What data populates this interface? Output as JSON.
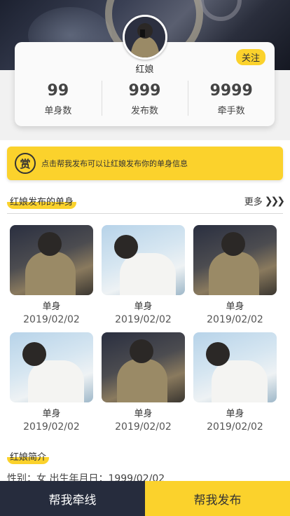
{
  "header": {
    "follow_label": "关注",
    "name": "红娘"
  },
  "stats": [
    {
      "value": "99",
      "label": "单身数"
    },
    {
      "value": "999",
      "label": "发布数"
    },
    {
      "value": "9999",
      "label": "牵手数"
    }
  ],
  "notice": {
    "icon_char": "赏",
    "text": "点击帮我发布可以让红娘发布你的单身信息"
  },
  "singles_section": {
    "title": "红娘发布的单身",
    "more_label": "更多",
    "more_icon": "❯❯❯"
  },
  "singles": [
    {
      "title": "单身",
      "date": "2019/02/02",
      "photo": "a"
    },
    {
      "title": "单身",
      "date": "2019/02/02",
      "photo": "b"
    },
    {
      "title": "单身",
      "date": "2019/02/02",
      "photo": "a"
    },
    {
      "title": "单身",
      "date": "2019/02/02",
      "photo": "b"
    },
    {
      "title": "单身",
      "date": "2019/02/02",
      "photo": "a"
    },
    {
      "title": "单身",
      "date": "2019/02/02",
      "photo": "b"
    }
  ],
  "intro_section": {
    "title": "红娘简介",
    "text": "性别：女  出生年月日：1999/02/02"
  },
  "bottom_bar": {
    "left_label": "帮我牵线",
    "right_label": "帮我发布"
  },
  "colors": {
    "accent": "#fbd22c",
    "dark": "#262c3d"
  }
}
